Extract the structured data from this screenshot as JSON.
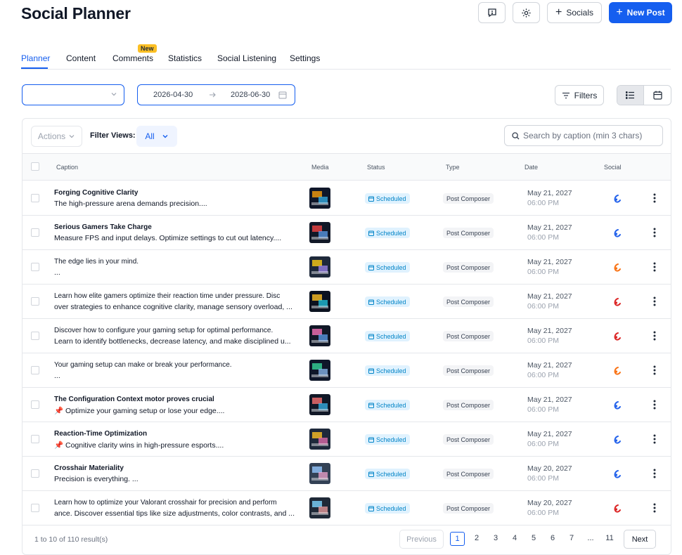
{
  "header": {
    "title": "Social Planner",
    "socials_label": "Socials",
    "new_post_label": "New Post"
  },
  "tabs": [
    {
      "label": "Planner",
      "active": true
    },
    {
      "label": "Content"
    },
    {
      "label": "Comments",
      "badge": "New"
    },
    {
      "label": "Statistics"
    },
    {
      "label": "Social Listening"
    },
    {
      "label": "Settings"
    }
  ],
  "filters": {
    "date_start": "2026-04-30",
    "date_end": "2028-06-30",
    "filters_label": "Filters"
  },
  "table_toolbar": {
    "actions_label": "Actions",
    "filter_views_label": "Filter Views:",
    "filter_view_value": "All",
    "search_placeholder": "Search by caption (min 3 chars)"
  },
  "columns": [
    "Caption",
    "Media",
    "Status",
    "Type",
    "Date",
    "Social"
  ],
  "rows": [
    {
      "title": "Forging Cognitive Clarity",
      "bold": true,
      "text": "The high-pressure arena demands precision....",
      "status": "Scheduled",
      "type": "Post Composer",
      "date": "May 21, 2027",
      "time": "06:00 PM",
      "social": "blue"
    },
    {
      "title": "Serious Gamers Take Charge",
      "bold": true,
      "text": "Measure FPS and input delays. Optimize settings to cut out latency....",
      "status": "Scheduled",
      "type": "Post Composer",
      "date": "May 21, 2027",
      "time": "06:00 PM",
      "social": "blue"
    },
    {
      "title": "The edge lies in your mind.",
      "bold": false,
      "text": "...",
      "status": "Scheduled",
      "type": "Post Composer",
      "date": "May 21, 2027",
      "time": "06:00 PM",
      "social": "orange"
    },
    {
      "title": "Learn how elite gamers optimize their reaction time under pressure. Disc",
      "bold": false,
      "text": "over strategies to enhance cognitive clarity, manage sensory overload, ...",
      "status": "Scheduled",
      "type": "Post Composer",
      "date": "May 21, 2027",
      "time": "06:00 PM",
      "social": "red"
    },
    {
      "title": "Discover how to configure your gaming setup for optimal performance.",
      "bold": false,
      "text": "Learn to identify bottlenecks, decrease latency, and make disciplined u...",
      "status": "Scheduled",
      "type": "Post Composer",
      "date": "May 21, 2027",
      "time": "06:00 PM",
      "social": "red"
    },
    {
      "title": "Your gaming setup can make or break your performance.",
      "bold": false,
      "text": "...",
      "status": "Scheduled",
      "type": "Post Composer",
      "date": "May 21, 2027",
      "time": "06:00 PM",
      "social": "orange"
    },
    {
      "title": "The Configuration Context motor proves crucial",
      "bold": true,
      "text": "📌 Optimize your gaming setup or lose your edge....",
      "status": "Scheduled",
      "type": "Post Composer",
      "date": "May 21, 2027",
      "time": "06:00 PM",
      "social": "blue"
    },
    {
      "title": "Reaction-Time Optimization",
      "bold": true,
      "text": "📌 Cognitive clarity wins in high-pressure esports....",
      "status": "Scheduled",
      "type": "Post Composer",
      "date": "May 21, 2027",
      "time": "06:00 PM",
      "social": "blue"
    },
    {
      "title": "Crosshair Materiality",
      "bold": true,
      "text": "Precision is everything. ...",
      "status": "Scheduled",
      "type": "Post Composer",
      "date": "May 20, 2027",
      "time": "06:00 PM",
      "social": "blue"
    },
    {
      "title": "Learn how to optimize your Valorant crosshair for precision and perform",
      "bold": false,
      "text": "ance. Discover essential tips like size adjustments, color contrasts, and ...",
      "status": "Scheduled",
      "type": "Post Composer",
      "date": "May 20, 2027",
      "time": "06:00 PM",
      "social": "red"
    }
  ],
  "pagination": {
    "summary": "1 to 10 of 110 result(s)",
    "previous_label": "Previous",
    "next_label": "Next",
    "pages": [
      "1",
      "2",
      "3",
      "4",
      "5",
      "6",
      "7",
      "...",
      "11"
    ],
    "current": "1"
  },
  "colors": {
    "accent": "#155eef",
    "status_bg": "#e0f2fe",
    "status_text": "#0284c7",
    "badge_new": "#fbbf24",
    "social_blue": "#2563eb",
    "social_orange": "#f97316",
    "social_red": "#dc2626"
  }
}
